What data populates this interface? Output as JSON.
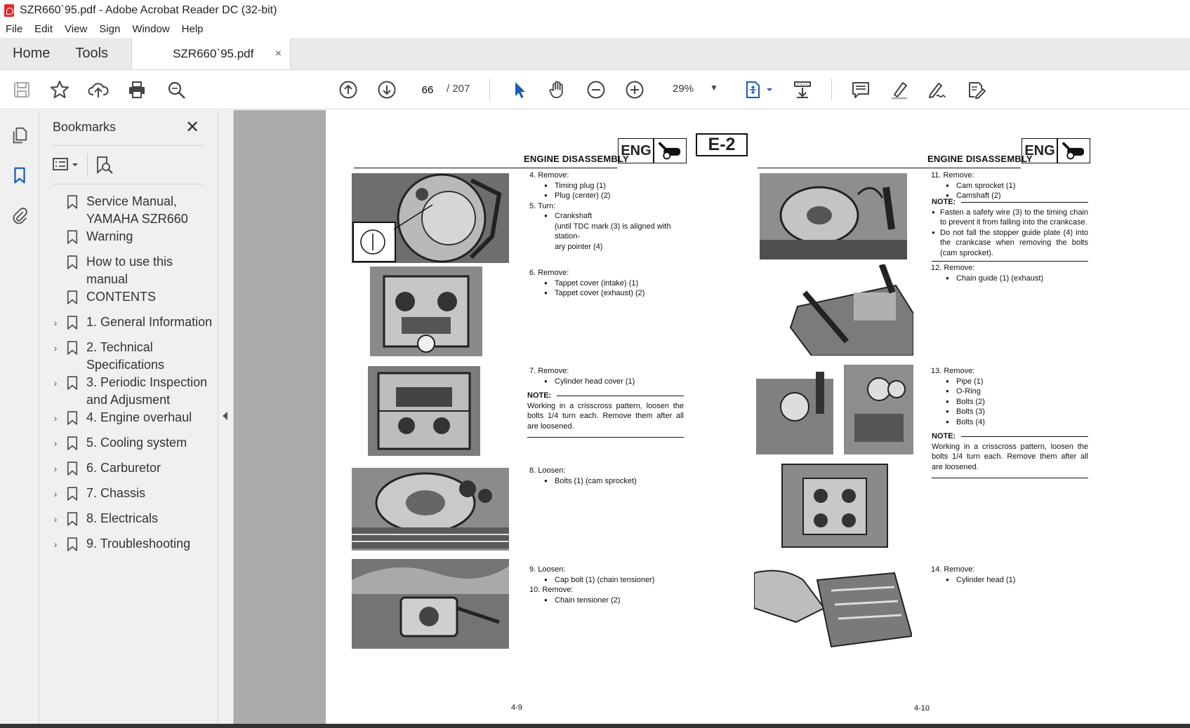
{
  "window": {
    "title": "SZR660`95.pdf - Adobe Acrobat Reader DC (32-bit)"
  },
  "menu": [
    "File",
    "Edit",
    "View",
    "Sign",
    "Window",
    "Help"
  ],
  "tabs": {
    "home": "Home",
    "tools": "Tools",
    "document": "SZR660`95.pdf",
    "close_glyph": "×"
  },
  "toolbar": {
    "current_page": "66",
    "page_total": "/  207",
    "zoom": "29%",
    "zoom_caret": "▼"
  },
  "bookmarks": {
    "header": "Bookmarks",
    "close_glyph": "✕",
    "items": [
      {
        "label": "Service Manual, YAMAHA SZR660",
        "expandable": false
      },
      {
        "label": "Warning",
        "expandable": false
      },
      {
        "label": "How to use this manual",
        "expandable": false
      },
      {
        "label": "CONTENTS",
        "expandable": false
      },
      {
        "label": "1. General Information",
        "expandable": true
      },
      {
        "label": "2. Technical Specifications",
        "expandable": true
      },
      {
        "label": "3. Periodic Inspection and Adjusment",
        "expandable": true
      },
      {
        "label": "4. Engine overhaul",
        "expandable": true
      },
      {
        "label": "5. Cooling system",
        "expandable": true
      },
      {
        "label": "6. Carburetor",
        "expandable": true
      },
      {
        "label": "7. Chassis",
        "expandable": true
      },
      {
        "label": "8. Electricals",
        "expandable": true
      },
      {
        "label": "9. Troubleshooting",
        "expandable": true
      }
    ],
    "expander_glyph": "›"
  },
  "page": {
    "header_title": "ENGINE DISASSEMBLY",
    "eng_label": "ENG",
    "section_tag": "E-2",
    "left_page_number": "4-9",
    "right_page_number": "4-10",
    "left_steps": [
      {
        "lines": [
          {
            "t": "step",
            "text": "4.  Remove:"
          },
          {
            "t": "sub",
            "text": "Timing plug (1)"
          },
          {
            "t": "sub",
            "text": "Plug (center) (2)"
          },
          {
            "t": "step",
            "text": "5.  Turn:"
          },
          {
            "t": "sub",
            "text": "Crankshaft"
          },
          {
            "t": "plain",
            "text": "(until TDC mark (3) is aligned with station-"
          },
          {
            "t": "plain",
            "text": "ary pointer (4)"
          }
        ]
      },
      {
        "lines": [
          {
            "t": "step",
            "text": "6.  Remove:"
          },
          {
            "t": "sub",
            "text": "Tappet cover (intake) (1)"
          },
          {
            "t": "sub",
            "text": "Tappet cover (exhaust) (2)"
          }
        ]
      },
      {
        "lines": [
          {
            "t": "step",
            "text": "7.  Remove:"
          },
          {
            "t": "sub",
            "text": "Cylinder head cover (1)"
          }
        ]
      },
      {
        "lines": [
          {
            "t": "step",
            "text": "8.  Loosen:"
          },
          {
            "t": "sub",
            "text": "Bolts (1) (cam sprocket)"
          }
        ]
      },
      {
        "lines": [
          {
            "t": "step",
            "text": "9.  Loosen:"
          },
          {
            "t": "sub",
            "text": "Cap bolt (1) (chain tensioner)"
          },
          {
            "t": "step",
            "text": "10.  Remove:"
          },
          {
            "t": "sub",
            "text": "Chain tensioner (2)"
          }
        ]
      }
    ],
    "left_note": {
      "title": "NOTE:",
      "text": "Working in a crisscross pattern, loosen the bolts 1/4 turn each. Remove them after all are loosened."
    },
    "right_steps": [
      {
        "lines": [
          {
            "t": "step",
            "text": "11.  Remove:"
          },
          {
            "t": "sub",
            "text": "Cam sprocket (1)"
          },
          {
            "t": "sub",
            "text": "Camshaft (2)"
          }
        ]
      },
      {
        "lines": [
          {
            "t": "step",
            "text": "12.  Remove:"
          },
          {
            "t": "sub",
            "text": "Chain guide (1) (exhaust)"
          }
        ]
      },
      {
        "lines": [
          {
            "t": "step",
            "text": "13.  Remove:"
          },
          {
            "t": "sub",
            "text": "Pipe (1)"
          },
          {
            "t": "sub",
            "text": "O-Ring"
          },
          {
            "t": "sub",
            "text": "Bolts (2)"
          },
          {
            "t": "sub",
            "text": "Bolts (3)"
          },
          {
            "t": "sub",
            "text": "Bolts (4)"
          }
        ]
      },
      {
        "lines": [
          {
            "t": "step",
            "text": "14.  Remove:"
          },
          {
            "t": "sub",
            "text": "Cylinder head (1)"
          }
        ]
      }
    ],
    "right_note1": {
      "title": "NOTE:",
      "bullets": [
        "Fasten a safety wire (3) to the timing chain to prevent it from falling into the crankcase.",
        "Do not fall the stopper guide plate (4) into the crankcase when removing the bolts (cam sprocket)."
      ]
    },
    "right_note2": {
      "title": "NOTE:",
      "text": "Working in a crisscross pattern, loosen the bolts 1/4 turn each. Remove them after all are loosened."
    }
  }
}
